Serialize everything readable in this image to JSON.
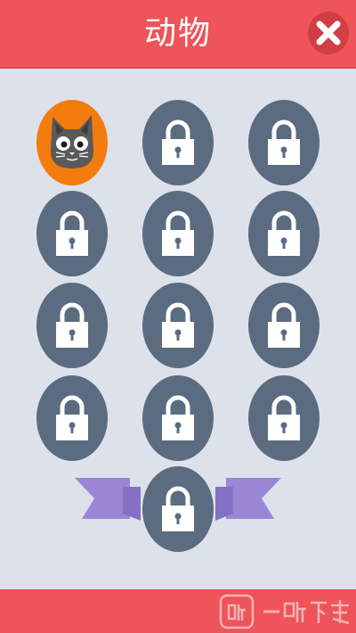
{
  "header": {
    "title": "动物"
  },
  "slots": [
    {
      "state": "unlocked",
      "animal": "cat"
    },
    {
      "state": "locked"
    },
    {
      "state": "locked"
    },
    {
      "state": "locked"
    },
    {
      "state": "locked"
    },
    {
      "state": "locked"
    },
    {
      "state": "locked"
    },
    {
      "state": "locked"
    },
    {
      "state": "locked"
    },
    {
      "state": "locked"
    },
    {
      "state": "locked"
    },
    {
      "state": "locked"
    },
    {
      "state": "locked",
      "special": "ribbon"
    }
  ],
  "icons": {
    "close": "close-icon",
    "lock": "lock-icon",
    "cat": "cat-icon"
  },
  "colors": {
    "header": "#ee5459",
    "background": "#dde1ea",
    "slot_locked": "#5b6b80",
    "slot_unlocked": "#f47c0f",
    "ribbon": "#9b86d6"
  },
  "watermark": {
    "text": "一听下载"
  }
}
